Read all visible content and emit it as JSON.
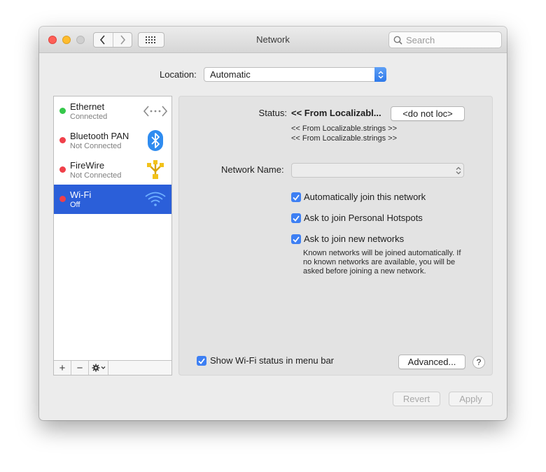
{
  "window": {
    "title": "Network"
  },
  "search": {
    "placeholder": "Search"
  },
  "location": {
    "label": "Location:",
    "value": "Automatic"
  },
  "services": [
    {
      "name": "Ethernet",
      "status": "Connected",
      "status_color": "#35c84a",
      "icon": "ethernet-icon"
    },
    {
      "name": "Bluetooth PAN",
      "status": "Not Connected",
      "status_color": "#f0404a",
      "icon": "bluetooth-icon"
    },
    {
      "name": "FireWire",
      "status": "Not Connected",
      "status_color": "#f0404a",
      "icon": "firewire-icon"
    },
    {
      "name": "Wi-Fi",
      "status": "Off",
      "status_color": "#f0404a",
      "icon": "wifi-icon",
      "selected": true
    }
  ],
  "sidebar_toolbar": {
    "add": "+",
    "remove": "−"
  },
  "detail": {
    "status_label": "Status:",
    "status_value": "<< From Localizabl...",
    "status_button": "<do not loc>",
    "status_line1": "<< From Localizable.strings >>",
    "status_line2": "<< From Localizable.strings >>",
    "network_name_label": "Network Name:",
    "network_name_value": "",
    "checkbox_auto_join": "Automatically join this network",
    "checkbox_personal_hotspots": "Ask to join Personal Hotspots",
    "checkbox_new_networks": "Ask to join new networks",
    "note": "Known networks will be joined automatically. If no known networks are available, you will be asked before joining a new network.",
    "show_menu_bar": "Show Wi-Fi status in menu bar",
    "advanced_button": "Advanced...",
    "help_button": "?"
  },
  "footer": {
    "revert": "Revert",
    "apply": "Apply"
  },
  "colors": {
    "accent": "#3d7ff3",
    "selection": "#2b5fd9"
  }
}
